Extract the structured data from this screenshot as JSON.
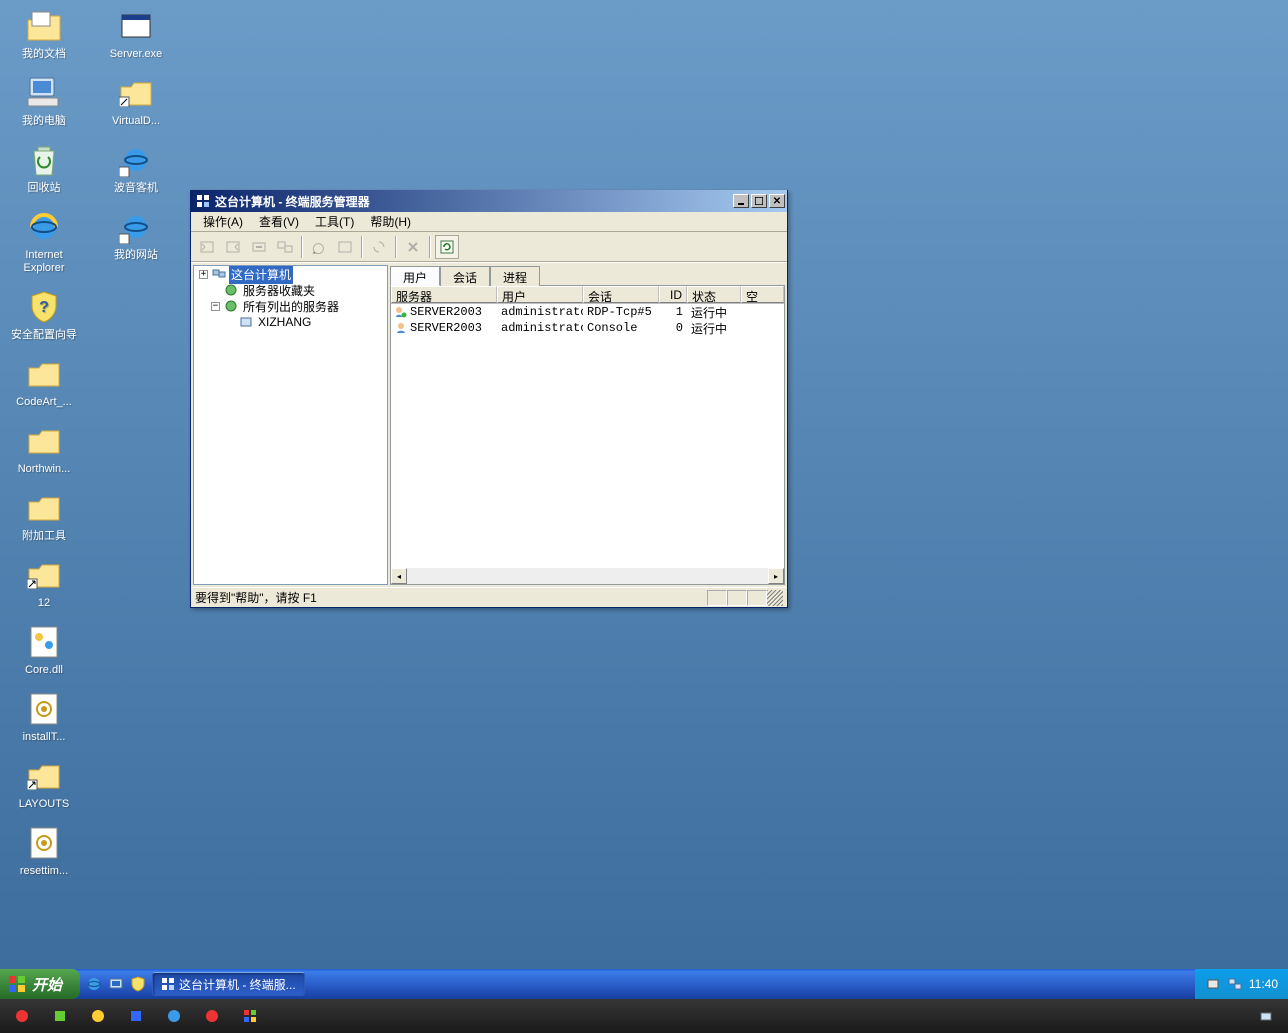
{
  "desktop": {
    "col1": [
      {
        "label": "我的文档"
      },
      {
        "label": "我的电脑"
      },
      {
        "label": "回收站"
      },
      {
        "label": "Internet Explorer"
      },
      {
        "label": "安全配置向导"
      },
      {
        "label": "CodeArt_..."
      },
      {
        "label": "Northwin..."
      },
      {
        "label": "附加工具"
      },
      {
        "label": "12"
      },
      {
        "label": "Core.dll"
      },
      {
        "label": "installT..."
      },
      {
        "label": "LAYOUTS"
      },
      {
        "label": "resettim..."
      }
    ],
    "col2": [
      {
        "label": "Server.exe"
      },
      {
        "label": "VirtualD..."
      },
      {
        "label": "波音客机"
      },
      {
        "label": "我的网站"
      }
    ]
  },
  "window": {
    "title": "这台计算机 - 终端服务管理器",
    "menubar": {
      "action": "操作(A)",
      "view": "查看(V)",
      "tools": "工具(T)",
      "help": "帮助(H)"
    },
    "tree": {
      "root": "这台计算机",
      "fav": "服务器收藏夹",
      "all": "所有列出的服务器",
      "server": "XIZHANG"
    },
    "tabs": {
      "users": "用户",
      "sessions": "会话",
      "processes": "进程"
    },
    "list": {
      "headers": {
        "server": "服务器",
        "user": "用户",
        "session": "会话",
        "id": "ID",
        "state": "状态",
        "idle": "空"
      },
      "rows": [
        {
          "server": "SERVER2003",
          "user": "administrator",
          "session": "RDP-Tcp#5",
          "id": "1",
          "state": "运行中"
        },
        {
          "server": "SERVER2003",
          "user": "administrator",
          "session": "Console",
          "id": "0",
          "state": "运行中"
        }
      ]
    },
    "status": "要得到\"帮助\"，请按 F1"
  },
  "taskbar": {
    "start": "开始",
    "task": "这台计算机 - 终端服...",
    "clock": "11:40"
  },
  "secondbar": {
    "items": [
      {
        "label": ""
      },
      {
        "label": ""
      },
      {
        "label": ""
      },
      {
        "label": ""
      },
      {
        "label": ""
      },
      {
        "label": ""
      },
      {
        "label": ""
      }
    ]
  }
}
